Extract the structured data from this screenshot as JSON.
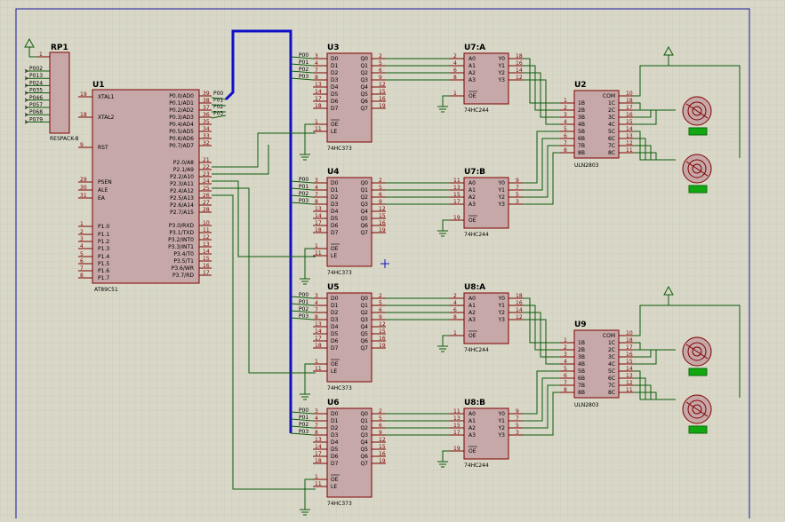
{
  "colors": {
    "background": "#d9d8c8",
    "grid": "#c4c3b2",
    "border": "#1a1aa0",
    "chip_fill": "#c6a8a8",
    "chip_stroke": "#800000",
    "wire": "#0a5a0a",
    "bus": "#1010c8",
    "motor_label": "#11a811"
  },
  "rp1": {
    "ref": "RP1",
    "part": "RESPACK-8",
    "pin1": "1",
    "pins": [
      "P002",
      "P013",
      "P024",
      "P035",
      "P046",
      "P057",
      "P068",
      "P079"
    ]
  },
  "u1": {
    "ref": "U1",
    "part": "AT89C51",
    "left": [
      {
        "n": "19",
        "l": "XTAL1"
      },
      {
        "n": "18",
        "l": "XTAL2"
      },
      {
        "n": "9",
        "l": "RST"
      },
      {
        "n": "29",
        "l": "PSEN"
      },
      {
        "n": "30",
        "l": "ALE"
      },
      {
        "n": "31",
        "l": "EA"
      },
      {
        "n": "1",
        "l": "P1.0"
      },
      {
        "n": "2",
        "l": "P1.1"
      },
      {
        "n": "3",
        "l": "P1.2"
      },
      {
        "n": "4",
        "l": "P1.3"
      },
      {
        "n": "5",
        "l": "P1.4"
      },
      {
        "n": "6",
        "l": "P1.5"
      },
      {
        "n": "7",
        "l": "P1.6"
      },
      {
        "n": "8",
        "l": "P1.7"
      }
    ],
    "right": [
      {
        "n": "39",
        "l": "P0.0/AD0"
      },
      {
        "n": "38",
        "l": "P0.1/AD1"
      },
      {
        "n": "37",
        "l": "P0.2/AD2"
      },
      {
        "n": "36",
        "l": "P0.3/AD3"
      },
      {
        "n": "35",
        "l": "P0.4/AD4"
      },
      {
        "n": "34",
        "l": "P0.5/AD5"
      },
      {
        "n": "33",
        "l": "P0.6/AD6"
      },
      {
        "n": "32",
        "l": "P0.7/AD7"
      },
      {
        "n": "21",
        "l": "P2.0/A8"
      },
      {
        "n": "22",
        "l": "P2.1/A9"
      },
      {
        "n": "23",
        "l": "P2.2/A10"
      },
      {
        "n": "24",
        "l": "P2.3/A11"
      },
      {
        "n": "25",
        "l": "P2.4/A12"
      },
      {
        "n": "26",
        "l": "P2.5/A13"
      },
      {
        "n": "27",
        "l": "P2.6/A14"
      },
      {
        "n": "28",
        "l": "P2.7/A15"
      },
      {
        "n": "10",
        "l": "P3.0/RXD"
      },
      {
        "n": "11",
        "l": "P3.1/TXD"
      },
      {
        "n": "12",
        "l": "P3.2/INT0"
      },
      {
        "n": "13",
        "l": "P3.3/INT1"
      },
      {
        "n": "14",
        "l": "P3.4/T0"
      },
      {
        "n": "15",
        "l": "P3.5/T1"
      },
      {
        "n": "16",
        "l": "P3.6/WR"
      },
      {
        "n": "17",
        "l": "P3.7/RD"
      }
    ],
    "bus_labels": [
      "P00",
      "P01",
      "P02",
      "P03"
    ]
  },
  "latches": [
    {
      "ref": "U3",
      "part": "74HC373"
    },
    {
      "ref": "U4",
      "part": "74HC373"
    },
    {
      "ref": "U5",
      "part": "74HC373"
    },
    {
      "ref": "U6",
      "part": "74HC373"
    }
  ],
  "latch_pins": {
    "in": [
      {
        "n": "3",
        "l": "D0"
      },
      {
        "n": "4",
        "l": "D1"
      },
      {
        "n": "7",
        "l": "D2"
      },
      {
        "n": "8",
        "l": "D3"
      },
      {
        "n": "13",
        "l": "D4"
      },
      {
        "n": "14",
        "l": "D5"
      },
      {
        "n": "17",
        "l": "D6"
      },
      {
        "n": "18",
        "l": "D7"
      }
    ],
    "out": [
      {
        "n": "2",
        "l": "Q0"
      },
      {
        "n": "5",
        "l": "Q1"
      },
      {
        "n": "6",
        "l": "Q2"
      },
      {
        "n": "9",
        "l": "Q3"
      },
      {
        "n": "12",
        "l": "Q4"
      },
      {
        "n": "15",
        "l": "Q5"
      },
      {
        "n": "16",
        "l": "Q6"
      },
      {
        "n": "19",
        "l": "Q7"
      }
    ],
    "oe": {
      "n": "1",
      "l": "OE"
    },
    "le": {
      "n": "11",
      "l": "LE"
    },
    "bus_labels": [
      "P00",
      "P01",
      "P02",
      "P03"
    ]
  },
  "buffers": [
    {
      "ref": "U7:A",
      "part": "74HC244",
      "in": [
        "2",
        "4",
        "6",
        "8"
      ],
      "out": [
        "18",
        "16",
        "14",
        "12"
      ],
      "oe": "1"
    },
    {
      "ref": "U7:B",
      "part": "74HC244",
      "in": [
        "11",
        "13",
        "15",
        "17"
      ],
      "out": [
        "9",
        "7",
        "5",
        "3"
      ],
      "oe": "19"
    },
    {
      "ref": "U8:A",
      "part": "74HC244",
      "in": [
        "2",
        "4",
        "6",
        "8"
      ],
      "out": [
        "18",
        "16",
        "14",
        "12"
      ],
      "oe": "1"
    },
    {
      "ref": "U8:B",
      "part": "74HC244",
      "in": [
        "11",
        "13",
        "15",
        "17"
      ],
      "out": [
        "9",
        "7",
        "5",
        "3"
      ],
      "oe": "19"
    }
  ],
  "buffer_labels": {
    "in": [
      "A0",
      "A1",
      "A2",
      "A3"
    ],
    "out": [
      "Y0",
      "Y1",
      "Y2",
      "Y3"
    ],
    "oe": "OE"
  },
  "drivers": [
    {
      "ref": "U2",
      "part": "ULN2803"
    },
    {
      "ref": "U9",
      "part": "ULN2803"
    }
  ],
  "driver_pins": {
    "in": [
      {
        "n": "1",
        "l": "1B"
      },
      {
        "n": "2",
        "l": "2B"
      },
      {
        "n": "3",
        "l": "3B"
      },
      {
        "n": "4",
        "l": "4B"
      },
      {
        "n": "5",
        "l": "5B"
      },
      {
        "n": "6",
        "l": "6B"
      },
      {
        "n": "7",
        "l": "7B"
      },
      {
        "n": "8",
        "l": "8B"
      }
    ],
    "com": {
      "n": "10",
      "l": "COM"
    },
    "out": [
      {
        "n": "18",
        "l": "1C"
      },
      {
        "n": "17",
        "l": "2C"
      },
      {
        "n": "16",
        "l": "3C"
      },
      {
        "n": "15",
        "l": "4C"
      },
      {
        "n": "14",
        "l": "5C"
      },
      {
        "n": "13",
        "l": "6C"
      },
      {
        "n": "12",
        "l": "7C"
      },
      {
        "n": "11",
        "l": "8C"
      }
    ]
  },
  "motor_count": 4
}
